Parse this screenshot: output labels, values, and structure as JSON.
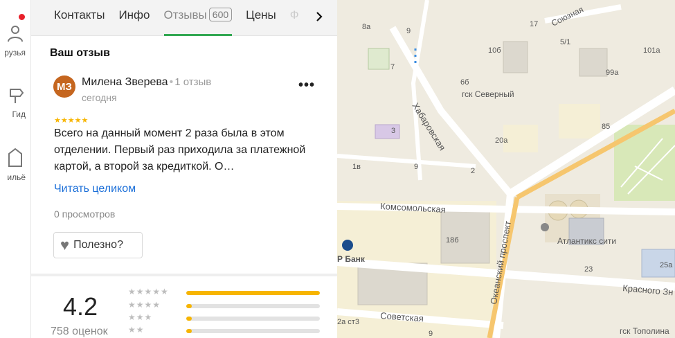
{
  "rail": {
    "items": [
      {
        "label": "рузья",
        "icon": "friends-icon"
      },
      {
        "label": "Гид",
        "icon": "guide-icon"
      },
      {
        "label": "ильё",
        "icon": "housing-icon"
      }
    ]
  },
  "tabs": {
    "items": [
      "Контакты",
      "Инфо",
      "Отзывы",
      "Цены",
      "Ф"
    ],
    "reviews_count": "600",
    "active": "Отзывы"
  },
  "review": {
    "section_title": "Ваш отзыв",
    "avatar_initials": "МЗ",
    "author": "Милена Зверева",
    "author_reviews": "1 отзыв",
    "date": "сегодня",
    "more": "•••",
    "rating": 5,
    "stars": "★★★★★",
    "text": "Всего на данный момент 2 раза была в этом отделении. Первый раз приходила за платежной картой, а второй за кредиткой. О…",
    "read_more": "Читать целиком",
    "views": "0 просмотров",
    "useful_label": "Полезно?"
  },
  "summary": {
    "rating": "4.2",
    "count": "758 оценок",
    "distribution": [
      {
        "stars": "★★★★★",
        "fraction": 1.0
      },
      {
        "stars": "★★★★",
        "fraction": 0.04
      },
      {
        "stars": "★★★",
        "fraction": 0.04
      },
      {
        "stars": "★★",
        "fraction": 0.04
      }
    ]
  },
  "map": {
    "streets": [
      "Союзная",
      "Хабаровская",
      "Комсомольская",
      "Океанский проспект",
      "Советская",
      "Красного Зн"
    ],
    "places": [
      "гск Северный",
      "Атлантикс сити",
      "Р Банк",
      "гск Тополина"
    ],
    "house_numbers": [
      "8а",
      "9",
      "7",
      "17",
      "5/1",
      "101а",
      "10б",
      "6б",
      "99а",
      "3",
      "85",
      "20а",
      "1в",
      "9",
      "2",
      "18б",
      "23",
      "25а",
      "2а ст3",
      "9"
    ]
  }
}
